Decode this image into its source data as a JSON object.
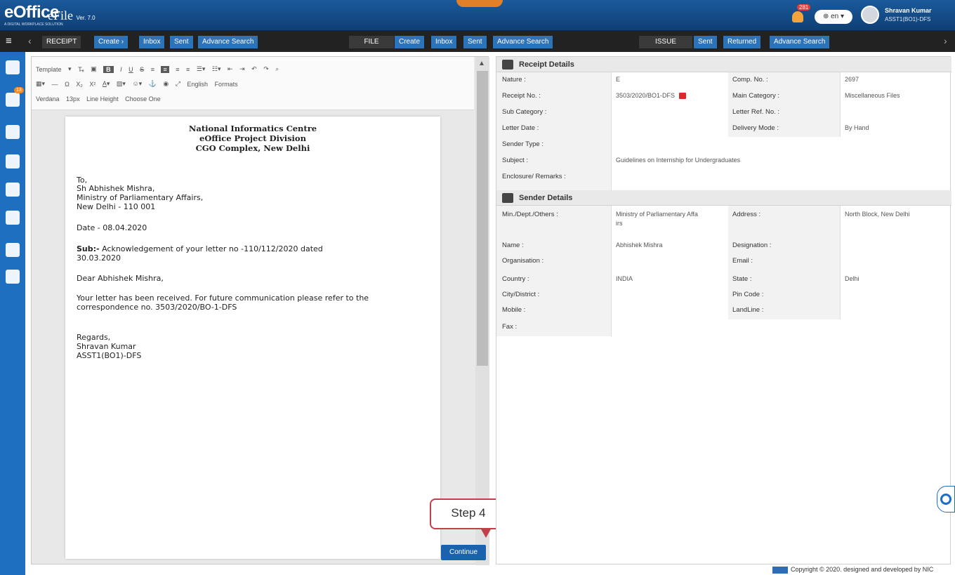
{
  "app": {
    "logo": "eOffice",
    "logo_tag": "A DIGITAL WORKPLACE SOLUTION",
    "product": "eFile",
    "version": "Ver. 7.0",
    "notifications": "281",
    "language": "en",
    "user_name": "Shravan Kumar",
    "user_designation": "ASST1(BO1)-DFS"
  },
  "nav": {
    "receipt": {
      "label": "RECEIPT",
      "create": "Create",
      "inbox": "Inbox",
      "sent": "Sent",
      "advance": "Advance Search"
    },
    "file": {
      "label": "FILE",
      "create": "Create",
      "inbox": "Inbox",
      "sent": "Sent",
      "advance": "Advance Search"
    },
    "issue": {
      "label": "ISSUE",
      "sent": "Sent",
      "returned": "Returned",
      "advance": "Advance Search"
    }
  },
  "sidebar": {
    "badge": "13"
  },
  "toolbar": {
    "template": "Template",
    "language": "English",
    "formats": "Formats",
    "font": "Verdana",
    "size": "13px",
    "line_height": "Line Height",
    "choose": "Choose One"
  },
  "letter": {
    "org": "National Informatics Centre",
    "division": "eOffice Project Division",
    "address": "CGO Complex, New Delhi",
    "to": "To,",
    "recipient": "Sh Abhishek Mishra,",
    "ministry": "Ministry of Parliamentary Affairs,",
    "city": "New Delhi - 110 001",
    "date": "Date - 08.04.2020",
    "sub_label": "Sub:-",
    "sub_text": " Acknowledgement of your letter no -110/112/2020 dated",
    "sub_date": "30.03.2020",
    "salutation": "Dear Abhishek Mishra,",
    "body1": "Your letter has been received. For future communication please refer to the",
    "body2": "correspondence no. 3503/2020/BO-1-DFS",
    "regards": "Regards,",
    "sign_name": "Shravan Kumar",
    "sign_desig": "ASST1(BO1)-DFS"
  },
  "continue_label": "Continue",
  "step_label": "Step 4",
  "receipt_details": {
    "title": "Receipt Details",
    "nature_lbl": "Nature :",
    "nature": "E",
    "comp_lbl": "Comp. No. :",
    "comp": "2697",
    "receipt_no_lbl": "Receipt No. :",
    "receipt_no": "3503/2020/BO1-DFS",
    "main_cat_lbl": "Main Category :",
    "main_cat": "Miscellaneous Files",
    "sub_cat_lbl": "Sub Category :",
    "letter_ref_lbl": "Letter Ref. No. :",
    "letter_date_lbl": "Letter Date :",
    "delivery_lbl": "Delivery Mode :",
    "delivery": "By Hand",
    "sender_type_lbl": "Sender Type :",
    "subject_lbl": "Subject :",
    "subject": "Guidelines on Internship for Undergraduates",
    "enclosure_lbl": "Enclosure/ Remarks :"
  },
  "sender_details": {
    "title": "Sender Details",
    "min_lbl": "Min./Dept./Others :",
    "min": "Ministry of Parliamentary Affa",
    "min2": "irs",
    "address_lbl": "Address :",
    "address": "North Block, New Delhi",
    "name_lbl": "Name :",
    "name": "Abhishek Mishra",
    "desig_lbl": "Designation :",
    "org_lbl": "Organisation :",
    "email_lbl": "Email :",
    "country_lbl": "Country :",
    "country": "INDIA",
    "state_lbl": "State :",
    "state": "Delhi",
    "city_lbl": "City/District :",
    "pin_lbl": "Pin Code :",
    "mobile_lbl": "Mobile :",
    "landline_lbl": "LandLine :",
    "fax_lbl": "Fax :"
  },
  "footer": "Copyright © 2020. designed and developed by NIC"
}
